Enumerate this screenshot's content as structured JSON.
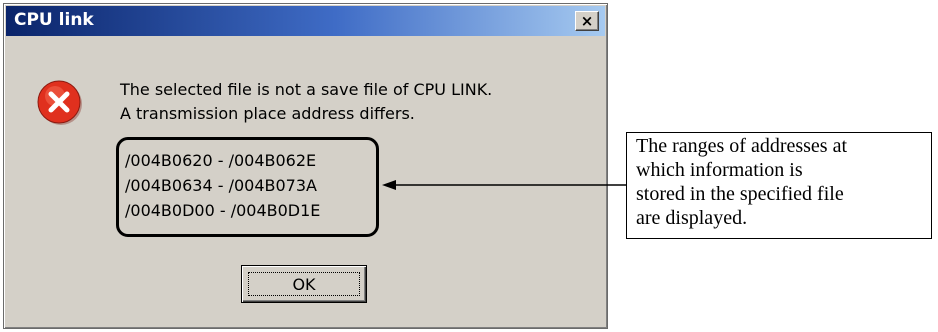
{
  "dialog": {
    "title": "CPU link",
    "close_label": "×",
    "message_lines": [
      "The selected file is not a save file of CPU LINK.",
      "A transmission place address differs."
    ],
    "address_ranges": [
      "/004B0620 - /004B062E",
      "/004B0634 - /004B073A",
      "/004B0D00 - /004B0D1E"
    ],
    "ok_label": "OK",
    "icon": "error-icon"
  },
  "annotation": {
    "lines": [
      "The ranges of addresses at",
      "which information is",
      "stored in the specified file",
      "are displayed."
    ]
  },
  "colors": {
    "title_bar_start": "#0a246a",
    "title_bar_end": "#a6caf0",
    "dialog_face": "#d4d0c8",
    "error_red": "#e0301e"
  }
}
